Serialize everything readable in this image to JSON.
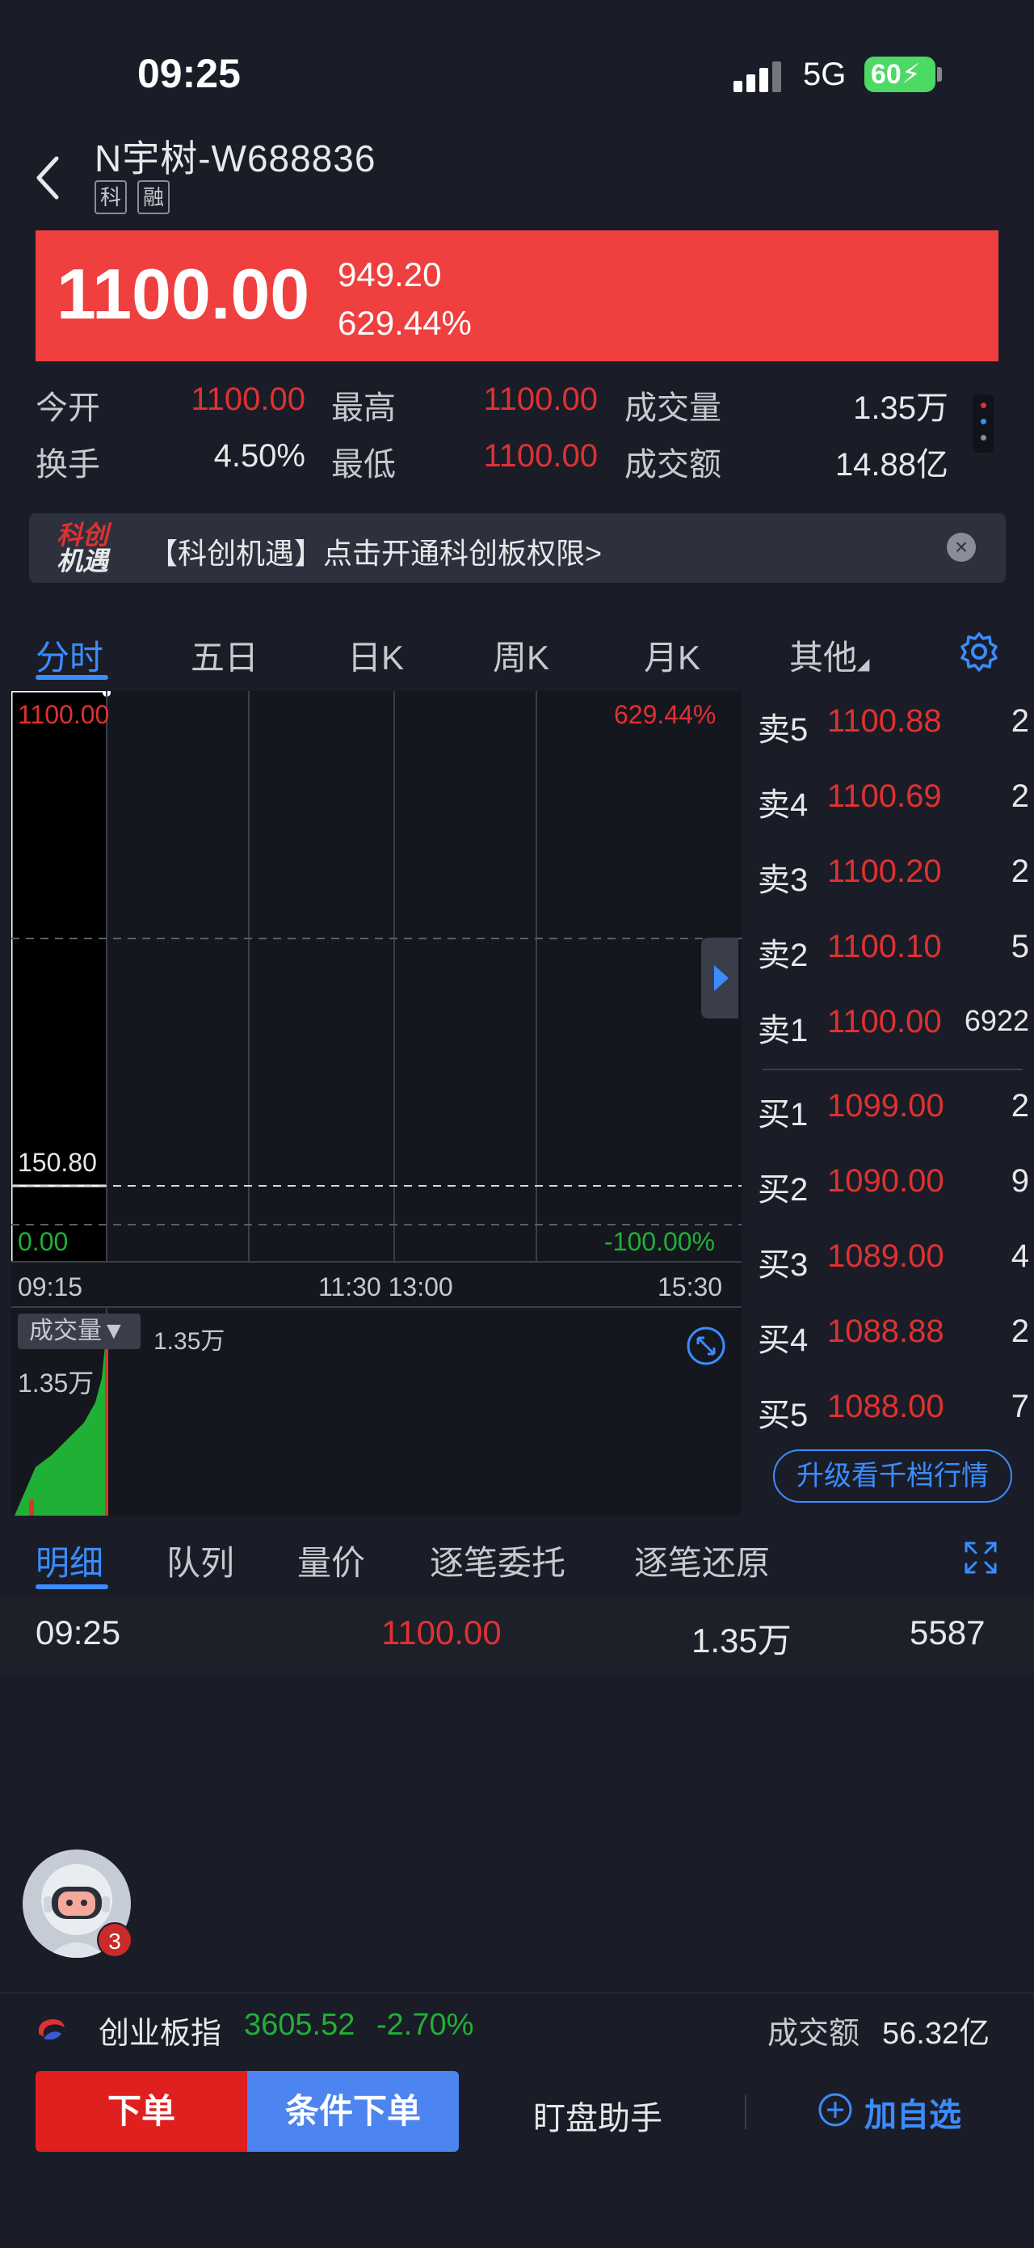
{
  "status": {
    "time": "09:25",
    "network": "5G",
    "battery": "60"
  },
  "header": {
    "name": "N宇树-W",
    "code": "688836",
    "tags": [
      "科",
      "融"
    ]
  },
  "quote": {
    "price": "1100.00",
    "change": "949.20",
    "change_pct": "629.44%"
  },
  "stats": [
    {
      "label": "今开",
      "value": "1100.00",
      "color": "red"
    },
    {
      "label": "最高",
      "value": "1100.00",
      "color": "red"
    },
    {
      "label": "成交量",
      "value": "1.35万",
      "color": "white"
    },
    {
      "label": "换手",
      "value": "4.50%",
      "color": "white"
    },
    {
      "label": "最低",
      "value": "1100.00",
      "color": "red"
    },
    {
      "label": "成交额",
      "value": "14.88亿",
      "color": "white"
    }
  ],
  "ad": {
    "logo_top": "科创",
    "logo_bottom": "机遇",
    "text": "【科创机遇】点击开通科创板权限>",
    "close": "×"
  },
  "chart_tabs": [
    "分时",
    "五日",
    "日K",
    "周K",
    "月K",
    "其他"
  ],
  "chart_labels": {
    "top_left": "1100.00",
    "top_right": "629.44%",
    "ref": "150.80",
    "bottom_left": "0.00",
    "bottom_right": "-100.00%",
    "times": [
      "09:15",
      "11:30 13:00",
      "15:30"
    ],
    "vol_selector": "成交量▼",
    "vol_value": "1.35万",
    "vol_axis": "1.35万"
  },
  "order_book": {
    "asks": [
      {
        "label": "卖5",
        "price": "1100.88",
        "qty": "2"
      },
      {
        "label": "卖4",
        "price": "1100.69",
        "qty": "2"
      },
      {
        "label": "卖3",
        "price": "1100.20",
        "qty": "2"
      },
      {
        "label": "卖2",
        "price": "1100.10",
        "qty": "5"
      },
      {
        "label": "卖1",
        "price": "1100.00",
        "qty": "6922"
      }
    ],
    "bids": [
      {
        "label": "买1",
        "price": "1099.00",
        "qty": "2"
      },
      {
        "label": "买2",
        "price": "1090.00",
        "qty": "9"
      },
      {
        "label": "买3",
        "price": "1089.00",
        "qty": "4"
      },
      {
        "label": "买4",
        "price": "1088.88",
        "qty": "2"
      },
      {
        "label": "买5",
        "price": "1088.00",
        "qty": "7"
      }
    ],
    "upgrade": "升级看千档行情"
  },
  "detail_tabs": [
    "明细",
    "队列",
    "量价",
    "逐笔委托",
    "逐笔还原"
  ],
  "ticks": [
    {
      "time": "09:25",
      "price": "1100.00",
      "volume": "1.35万",
      "count": "5587"
    }
  ],
  "avatar_badge": "3",
  "index": {
    "name": "创业板指",
    "value": "3605.52",
    "change": "-2.70%",
    "turnover_label": "成交额",
    "turnover": "56.32亿"
  },
  "actions": {
    "order": "下单",
    "conditional": "条件下单",
    "assistant": "盯盘助手",
    "add": "加自选"
  },
  "colors": {
    "up": "#e03131",
    "down": "#21b036",
    "accent": "#3b8cff",
    "banner": "#ef3f3f"
  }
}
